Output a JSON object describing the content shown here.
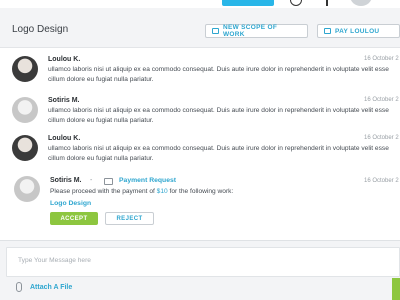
{
  "header": {
    "title": "Logo Design",
    "scope_button": "NEW SCOPE OF WORK",
    "pay_button": "PAY LOULOU"
  },
  "messages": [
    {
      "name": "Loulou K.",
      "date": "16 October 2",
      "text": "ullamco laboris nisi ut aliquip ex ea commodo consequat. Duis aute irure dolor in reprehenderit in voluptate velit esse cillum dolore eu fugiat nulla pariatur."
    },
    {
      "name": "Sotiris M.",
      "date": "16 October 2",
      "text": "ullamco laboris nisi ut aliquip ex ea commodo consequat. Duis aute irure dolor in reprehenderit in voluptate velit esse cillum dolore eu fugiat nulla pariatur."
    },
    {
      "name": "Loulou K.",
      "date": "16 October 2",
      "text": "ullamco laboris nisi ut aliquip ex ea commodo consequat. Duis aute irure dolor in reprehenderit in voluptate velit esse cillum dolore eu fugiat nulla pariatur."
    }
  ],
  "payment_request": {
    "name": "Sotiris M.",
    "separator": "-",
    "label": "Payment Request",
    "date": "16 October 2",
    "text_before": "Please proceed with the payment of ",
    "amount": "$10",
    "text_after": " for the following work:",
    "item": "Logo Design",
    "accept": "ACCEPT",
    "reject": "REJECT"
  },
  "composer": {
    "placeholder": "Type Your Message here",
    "attach": "Attach A File"
  }
}
